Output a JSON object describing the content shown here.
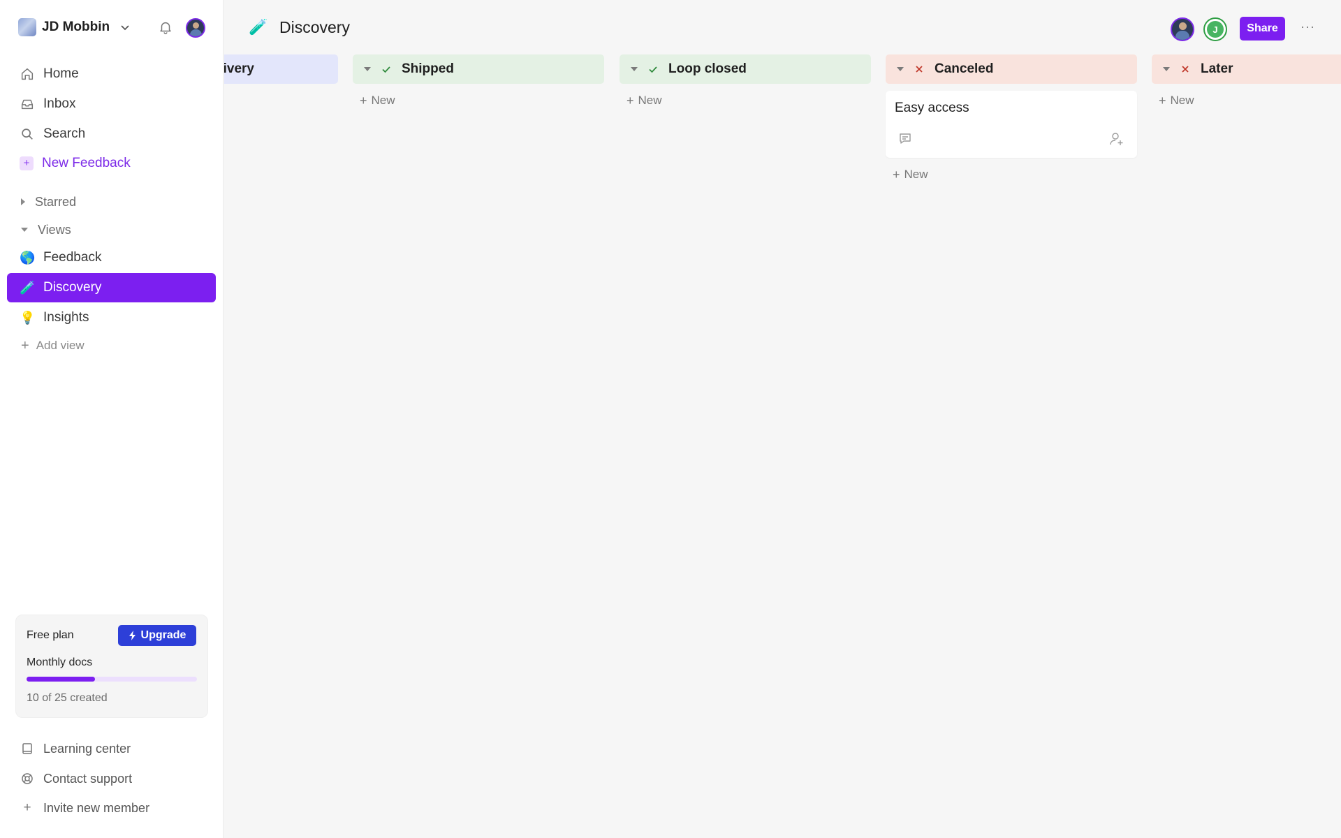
{
  "workspace": {
    "name": "JD Mobbin"
  },
  "nav": {
    "home": "Home",
    "inbox": "Inbox",
    "search": "Search",
    "new_feedback": "New Feedback",
    "starred": "Starred",
    "views": "Views",
    "view_items": [
      {
        "emoji": "🌎",
        "label": "Feedback"
      },
      {
        "emoji": "🧪",
        "label": "Discovery"
      },
      {
        "emoji": "💡",
        "label": "Insights"
      }
    ],
    "add_view": "Add view"
  },
  "plan": {
    "title": "Free plan",
    "upgrade": "Upgrade",
    "docs_label": "Monthly docs",
    "progress_fraction": 0.4,
    "count_text": "10 of 25 created"
  },
  "footer": {
    "learning": "Learning center",
    "support": "Contact support",
    "invite": "Invite new member"
  },
  "page": {
    "emoji": "🧪",
    "title": "Discovery",
    "collaborator_initial": "J",
    "share": "Share",
    "more": "···"
  },
  "board": {
    "new_label": "New",
    "columns": [
      {
        "title": "ivery",
        "icon": "none",
        "color": "#e3e6fb"
      },
      {
        "title": "Shipped",
        "icon": "check-icon",
        "color": "#e4f1e4"
      },
      {
        "title": "Loop closed",
        "icon": "check-icon",
        "color": "#e4f1e4"
      },
      {
        "title": "Canceled",
        "icon": "x-icon",
        "color": "#f9e3dd",
        "cards": [
          {
            "title": "Easy access"
          }
        ]
      },
      {
        "title": "Later",
        "icon": "x-icon",
        "color": "#f9e3dd"
      }
    ]
  },
  "colors": {
    "accent": "#7c1ff0",
    "upgrade": "#2d3fd8"
  }
}
